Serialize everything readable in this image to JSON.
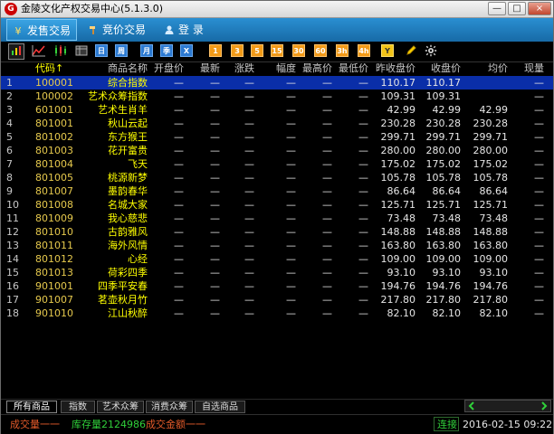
{
  "window": {
    "title": "金陵文化产权交易中心(5.1.3.0)",
    "buttons": {
      "minimize": "—",
      "maximize": "□",
      "close": "×"
    }
  },
  "menu_tabs": [
    {
      "label": "发售交易",
      "icon": "yen-icon",
      "active": true
    },
    {
      "label": "竞价交易",
      "icon": "hammer-icon",
      "active": false
    },
    {
      "label": "登  录",
      "icon": "user-icon",
      "active": false
    }
  ],
  "toolbar": {
    "blue_labels": [
      "日",
      "周",
      "月",
      "季",
      "X"
    ],
    "orange_labels": [
      "1",
      "3",
      "5",
      "15",
      "30",
      "60",
      "3h",
      "4h",
      "Y"
    ]
  },
  "table": {
    "headers": [
      "",
      "代码↑",
      "商品名称",
      "开盘价",
      "最新",
      "涨跌",
      "幅度",
      "最高价",
      "最低价",
      "昨收盘价",
      "收盘价",
      "均价",
      "现量"
    ],
    "rows": [
      {
        "idx": "1",
        "code": "100001",
        "name": "综合指数",
        "open": "—",
        "last": "—",
        "chg": "—",
        "pct": "—",
        "high": "—",
        "low": "—",
        "prev": "110.17",
        "close": "110.17",
        "avg": "",
        "vol": "—"
      },
      {
        "idx": "2",
        "code": "100002",
        "name": "艺术众筹指数",
        "open": "—",
        "last": "—",
        "chg": "—",
        "pct": "—",
        "high": "—",
        "low": "—",
        "prev": "109.31",
        "close": "109.31",
        "avg": "",
        "vol": "—"
      },
      {
        "idx": "3",
        "code": "601001",
        "name": "艺术生肖羊",
        "open": "—",
        "last": "—",
        "chg": "—",
        "pct": "—",
        "high": "—",
        "low": "—",
        "prev": "42.99",
        "close": "42.99",
        "avg": "42.99",
        "vol": "—"
      },
      {
        "idx": "4",
        "code": "801001",
        "name": "秋山云起",
        "open": "—",
        "last": "—",
        "chg": "—",
        "pct": "—",
        "high": "—",
        "low": "—",
        "prev": "230.28",
        "close": "230.28",
        "avg": "230.28",
        "vol": "—"
      },
      {
        "idx": "5",
        "code": "801002",
        "name": "东方猴王",
        "open": "—",
        "last": "—",
        "chg": "—",
        "pct": "—",
        "high": "—",
        "low": "—",
        "prev": "299.71",
        "close": "299.71",
        "avg": "299.71",
        "vol": "—"
      },
      {
        "idx": "6",
        "code": "801003",
        "name": "花开富贵",
        "open": "—",
        "last": "—",
        "chg": "—",
        "pct": "—",
        "high": "—",
        "low": "—",
        "prev": "280.00",
        "close": "280.00",
        "avg": "280.00",
        "vol": "—"
      },
      {
        "idx": "7",
        "code": "801004",
        "name": "飞天",
        "open": "—",
        "last": "—",
        "chg": "—",
        "pct": "—",
        "high": "—",
        "low": "—",
        "prev": "175.02",
        "close": "175.02",
        "avg": "175.02",
        "vol": "—"
      },
      {
        "idx": "8",
        "code": "801005",
        "name": "桃源新梦",
        "open": "—",
        "last": "—",
        "chg": "—",
        "pct": "—",
        "high": "—",
        "low": "—",
        "prev": "105.78",
        "close": "105.78",
        "avg": "105.78",
        "vol": "—"
      },
      {
        "idx": "9",
        "code": "801007",
        "name": "墨韵春华",
        "open": "—",
        "last": "—",
        "chg": "—",
        "pct": "—",
        "high": "—",
        "low": "—",
        "prev": "86.64",
        "close": "86.64",
        "avg": "86.64",
        "vol": "—"
      },
      {
        "idx": "10",
        "code": "801008",
        "name": "名城大家",
        "open": "—",
        "last": "—",
        "chg": "—",
        "pct": "—",
        "high": "—",
        "low": "—",
        "prev": "125.71",
        "close": "125.71",
        "avg": "125.71",
        "vol": "—"
      },
      {
        "idx": "11",
        "code": "801009",
        "name": "我心慈悲",
        "open": "—",
        "last": "—",
        "chg": "—",
        "pct": "—",
        "high": "—",
        "low": "—",
        "prev": "73.48",
        "close": "73.48",
        "avg": "73.48",
        "vol": "—"
      },
      {
        "idx": "12",
        "code": "801010",
        "name": "古韵雅风",
        "open": "—",
        "last": "—",
        "chg": "—",
        "pct": "—",
        "high": "—",
        "low": "—",
        "prev": "148.88",
        "close": "148.88",
        "avg": "148.88",
        "vol": "—"
      },
      {
        "idx": "13",
        "code": "801011",
        "name": "海外风情",
        "open": "—",
        "last": "—",
        "chg": "—",
        "pct": "—",
        "high": "—",
        "low": "—",
        "prev": "163.80",
        "close": "163.80",
        "avg": "163.80",
        "vol": "—"
      },
      {
        "idx": "14",
        "code": "801012",
        "name": "心经",
        "open": "—",
        "last": "—",
        "chg": "—",
        "pct": "—",
        "high": "—",
        "low": "—",
        "prev": "109.00",
        "close": "109.00",
        "avg": "109.00",
        "vol": "—"
      },
      {
        "idx": "15",
        "code": "801013",
        "name": "荷彩四季",
        "open": "—",
        "last": "—",
        "chg": "—",
        "pct": "—",
        "high": "—",
        "low": "—",
        "prev": "93.10",
        "close": "93.10",
        "avg": "93.10",
        "vol": "—"
      },
      {
        "idx": "16",
        "code": "901001",
        "name": "四季平安春",
        "open": "—",
        "last": "—",
        "chg": "—",
        "pct": "—",
        "high": "—",
        "low": "—",
        "prev": "194.76",
        "close": "194.76",
        "avg": "194.76",
        "vol": "—"
      },
      {
        "idx": "17",
        "code": "901007",
        "name": "茗壶秋月竹",
        "open": "—",
        "last": "—",
        "chg": "—",
        "pct": "—",
        "high": "—",
        "low": "—",
        "prev": "217.80",
        "close": "217.80",
        "avg": "217.80",
        "vol": "—"
      },
      {
        "idx": "18",
        "code": "901010",
        "name": "江山秋醉",
        "open": "—",
        "last": "—",
        "chg": "—",
        "pct": "—",
        "high": "—",
        "low": "—",
        "prev": "82.10",
        "close": "82.10",
        "avg": "82.10",
        "vol": "—"
      }
    ]
  },
  "bottom_tabs": [
    "所有商品",
    "指数",
    "艺术众筹",
    "消费众筹",
    "自选商品"
  ],
  "status": {
    "left1": "成交量一一",
    "left2": "库存量2124986",
    "left3": "成交金额一一",
    "connection": "连接",
    "datetime": "2016-02-15 09:22"
  },
  "colors": {
    "background": "#000000",
    "menu_blue": "#1f7fc0",
    "selected_row": "#0a2ea8",
    "yellow": "#ffff00",
    "green": "#30d03a",
    "red": "#e35a2a"
  }
}
